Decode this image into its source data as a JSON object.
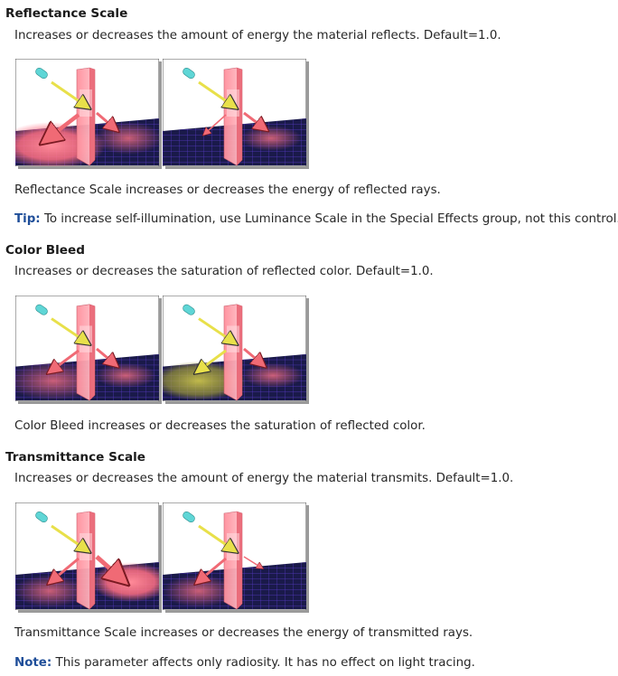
{
  "sections": [
    {
      "title": "Reflectance Scale",
      "description": "Increases or decreases the amount of energy the material reflects. Default=1.0.",
      "caption": "Reflectance Scale increases or decreases the energy of reflected rays.",
      "tip": {
        "label": "Tip:",
        "text": "To increase self-illumination, use Luminance Scale in the Special Effects group, not this control."
      }
    },
    {
      "title": "Color Bleed",
      "description": "Increases or decreases the saturation of reflected color. Default=1.0.",
      "caption": "Color Bleed increases or decreases the saturation of reflected color."
    },
    {
      "title": "Transmittance Scale",
      "description": "Increases or decreases the amount of energy the material transmits. Default=1.0.",
      "caption": "Transmittance Scale increases or decreases the energy of transmitted rays.",
      "note": {
        "label": "Note:",
        "text": "This parameter affects only radiosity. It has no effect on light tracing."
      }
    }
  ],
  "colors": {
    "label": "#1f4e99",
    "floor": "#1a1a4a",
    "grid": "#6b3fd6",
    "panel": "#ff9aa6",
    "arrow_red": "#f06a75",
    "arrow_yellow": "#e8e04a",
    "light": "#5fd6d6"
  }
}
